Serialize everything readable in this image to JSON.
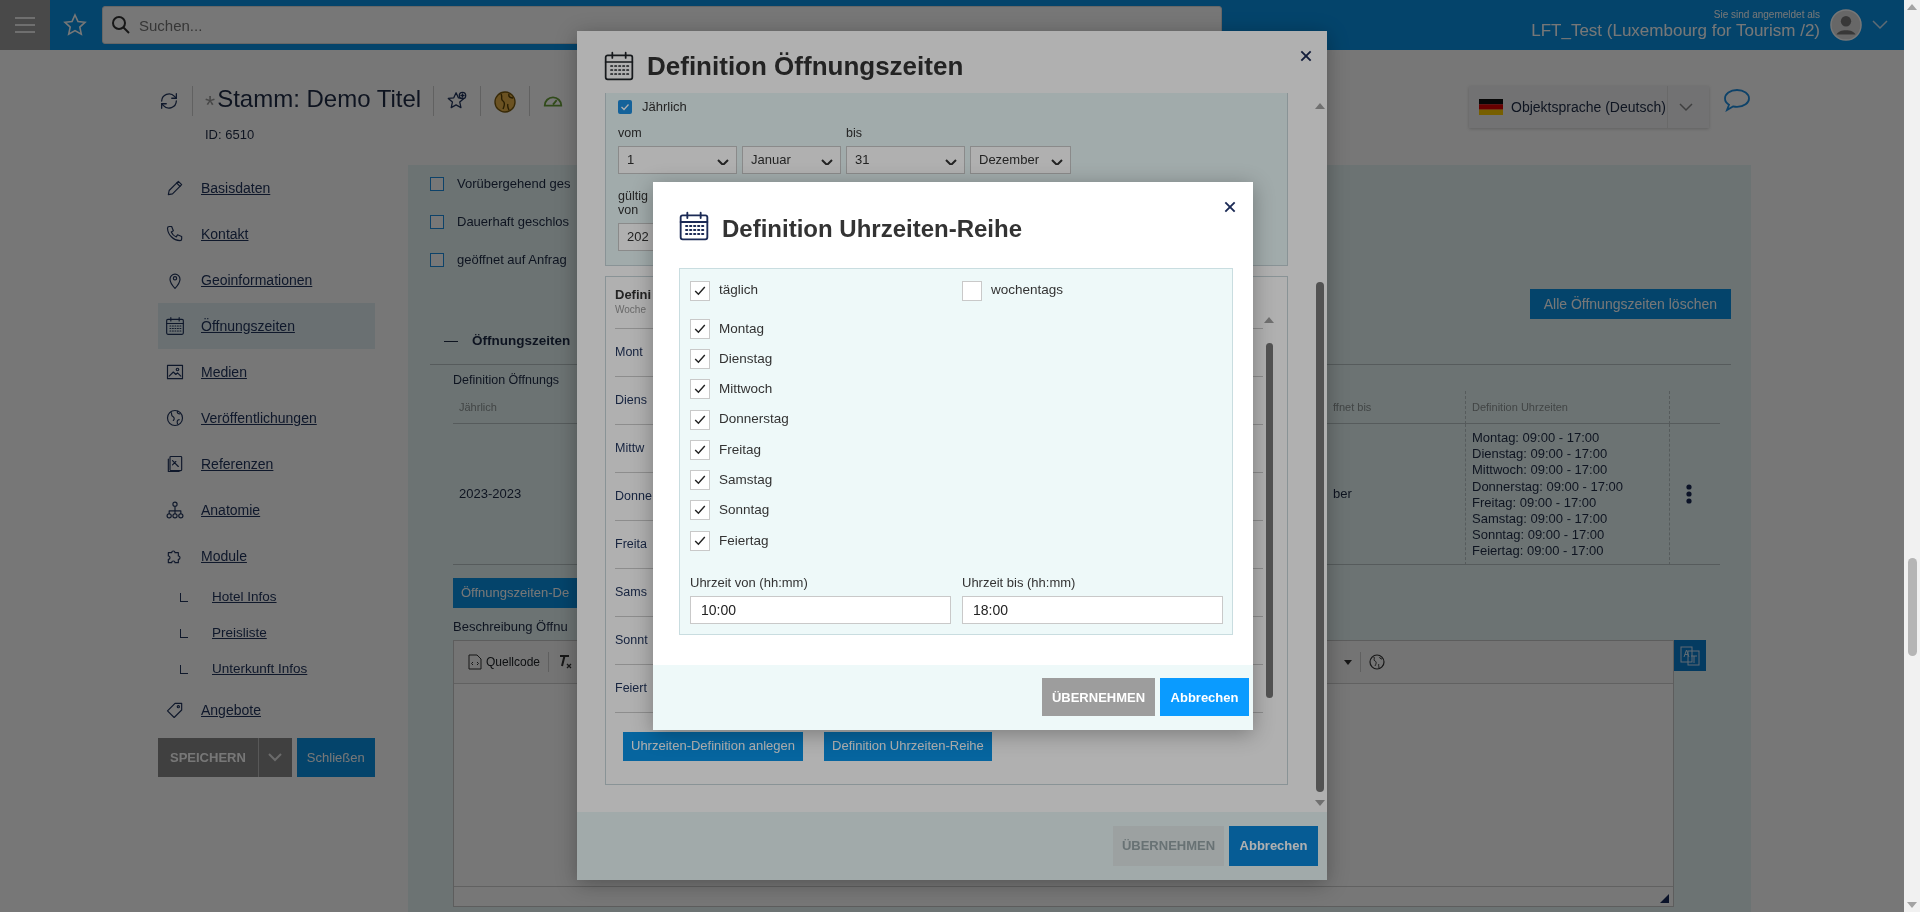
{
  "topbar": {
    "search_placeholder": "Suchen...",
    "login_caption": "Sie sind angemeldet als",
    "user": "LFT_Test (Luxembourg for Tourism /2)"
  },
  "header": {
    "modified_mark": "*",
    "title": "Stamm: Demo Titel",
    "id": "ID: 6510",
    "language": "Objektsprache (Deutsch)"
  },
  "sidebar": {
    "items": [
      {
        "label": "Basisdaten",
        "selected": false
      },
      {
        "label": "Kontakt",
        "selected": false
      },
      {
        "label": "Geoinformationen",
        "selected": false
      },
      {
        "label": "Öffnungszeiten",
        "selected": true
      },
      {
        "label": "Medien",
        "selected": false
      },
      {
        "label": "Veröffentlichungen",
        "selected": false
      },
      {
        "label": "Referenzen",
        "selected": false
      },
      {
        "label": "Anatomie",
        "selected": false
      },
      {
        "label": "Module",
        "selected": false,
        "children": [
          {
            "label": "Hotel Infos"
          },
          {
            "label": "Preisliste"
          },
          {
            "label": "Unterkunft Infos"
          }
        ]
      },
      {
        "label": "Angebote",
        "selected": false
      }
    ]
  },
  "actions": {
    "save": "SPEICHERN",
    "close": "Schließen"
  },
  "main": {
    "options": [
      {
        "label": "Vorübergehend ges",
        "checked": false
      },
      {
        "label": "Dauerhaft geschlos",
        "checked": false
      },
      {
        "label": "geöffnet auf Anfrag",
        "checked": false
      }
    ],
    "delete_all_button": "Alle Öffnungszeiten löschen",
    "section_title": "Öffnungszeiten",
    "table": {
      "caption": "Definition Öffnungs",
      "columns": [
        "Jährlich",
        "ffnet bis",
        "Definition Uhrzeiten"
      ],
      "rows": [
        {
          "period": "2023-2023",
          "column_2": "ber",
          "hours": [
            "Montag: 09:00 - 17:00",
            "Dienstag: 09:00 - 17:00",
            "Mittwoch: 09:00 - 17:00",
            "Donnerstag: 09:00 - 17:00",
            "Freitag: 09:00 - 17:00",
            "Samstag: 09:00 - 17:00",
            "Sonntag: 09:00 - 17:00",
            "Feiertag: 09:00 - 17:00"
          ]
        }
      ]
    },
    "definition_button": "Öffnungszeiten-De",
    "description_label": "Beschreibung Öffnu",
    "editor": {
      "source_button": "Quellcode"
    }
  },
  "outer_dialog": {
    "title": "Definition Öffnungszeiten",
    "yearly": {
      "label": "Jährlich",
      "checked": true
    },
    "from_label": "vom",
    "to_label": "bis",
    "from_day": "1",
    "from_month": "Januar",
    "to_day": "31",
    "to_month": "Dezember",
    "valid_from_label": "gültig von",
    "valid_from_value": "202",
    "hours_title": "Defini",
    "hours_column": "Woche",
    "hours_rows": [
      "Mont",
      "Diens",
      "Mittw",
      "Donne",
      "Freita",
      "Sams",
      "Sonnt",
      "Feiert"
    ],
    "buttons": [
      "Uhrzeiten-Definition anlegen",
      "Definition Uhrzeiten-Reihe"
    ],
    "footer": {
      "apply": {
        "label": "ÜBERNEHMEN",
        "disabled": true
      },
      "cancel": "Abbrechen"
    }
  },
  "inner_dialog": {
    "title": "Definition Uhrzeiten-Reihe",
    "presets": [
      {
        "label": "täglich",
        "checked": true
      },
      {
        "label": "wochentags",
        "checked": false
      }
    ],
    "days": [
      {
        "label": "Montag",
        "checked": true
      },
      {
        "label": "Dienstag",
        "checked": true
      },
      {
        "label": "Mittwoch",
        "checked": true
      },
      {
        "label": "Donnerstag",
        "checked": true
      },
      {
        "label": "Freitag",
        "checked": true
      },
      {
        "label": "Samstag",
        "checked": true
      },
      {
        "label": "Sonntag",
        "checked": true
      },
      {
        "label": "Feiertag",
        "checked": true
      }
    ],
    "time_from": {
      "label": "Uhrzeit von (hh:mm)",
      "value": "10:00"
    },
    "time_to": {
      "label": "Uhrzeit bis (hh:mm)",
      "value": "18:00"
    },
    "footer": {
      "apply": {
        "label": "ÜBERNEHMEN",
        "disabled": false
      },
      "cancel": "Abbrechen"
    }
  }
}
